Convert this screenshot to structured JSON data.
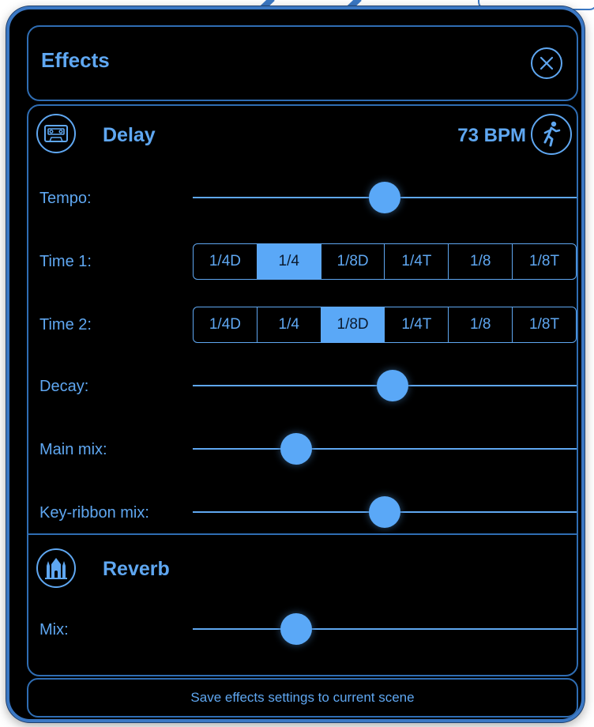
{
  "header": {
    "title": "Effects",
    "close_icon": "close-icon"
  },
  "delay": {
    "title": "Delay",
    "icon": "cassette-tape-icon",
    "bpm": "73 BPM",
    "tap_icon": "running-person-icon",
    "tempo": {
      "label": "Tempo:",
      "value": 0.5
    },
    "time1": {
      "label": "Time 1:",
      "options": [
        "1/4D",
        "1/4",
        "1/8D",
        "1/4T",
        "1/8",
        "1/8T"
      ],
      "selected": "1/4"
    },
    "time2": {
      "label": "Time 2:",
      "options": [
        "1/4D",
        "1/4",
        "1/8D",
        "1/4T",
        "1/8",
        "1/8T"
      ],
      "selected": "1/8D"
    },
    "decay": {
      "label": "Decay:",
      "value": 0.52
    },
    "main_mix": {
      "label": "Main mix:",
      "value": 0.27
    },
    "key_ribbon_mix": {
      "label": "Key-ribbon mix:",
      "value": 0.5
    }
  },
  "reverb": {
    "title": "Reverb",
    "icon": "cathedral-icon",
    "mix": {
      "label": "Mix:",
      "value": 0.27
    }
  },
  "footer": {
    "save_label": "Save effects settings to current scene"
  },
  "colors": {
    "accent": "#5fa7f1",
    "border": "#2f6db3",
    "background": "#000000",
    "thumb": "#5aa8f7"
  }
}
